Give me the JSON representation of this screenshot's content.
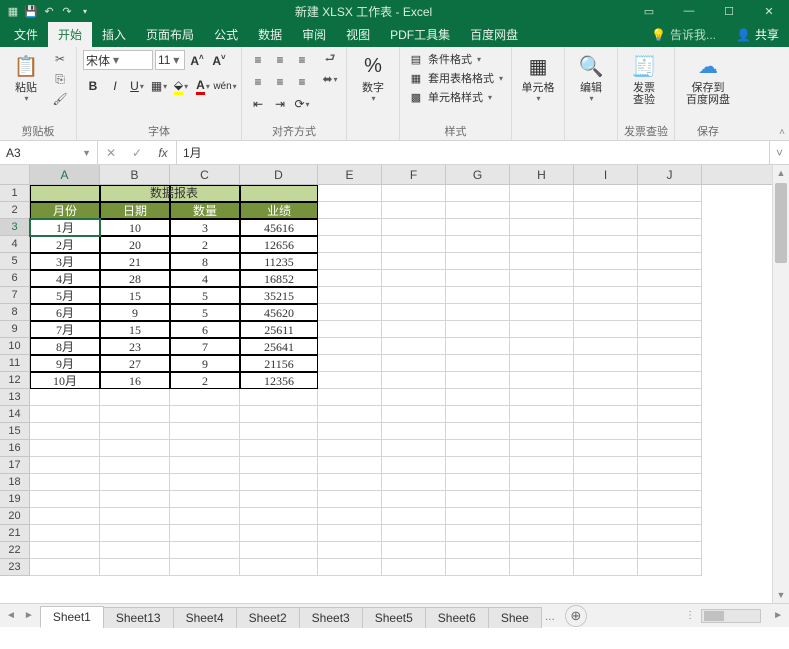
{
  "titlebar": {
    "title": "新建 XLSX 工作表 - Excel"
  },
  "tabs": {
    "items": [
      "文件",
      "开始",
      "插入",
      "页面布局",
      "公式",
      "数据",
      "审阅",
      "视图",
      "PDF工具集",
      "百度网盘"
    ],
    "active": 1,
    "tell_me": "告诉我...",
    "share": "共享"
  },
  "ribbon": {
    "clipboard": {
      "paste": "粘贴",
      "label": "剪贴板"
    },
    "font": {
      "name": "宋体",
      "size": "11",
      "label": "字体"
    },
    "align": {
      "label": "对齐方式"
    },
    "number": {
      "btn": "数字",
      "label": ""
    },
    "styles": {
      "cond": "条件格式",
      "tablefmt": "套用表格格式",
      "cellstyle": "单元格样式",
      "label": "样式"
    },
    "cells": {
      "btn": "单元格",
      "label": ""
    },
    "editing": {
      "btn": "编辑",
      "label": ""
    },
    "invoice": {
      "btn": "发票\n查验",
      "label": "发票查验"
    },
    "baidu": {
      "btn": "保存到\n百度网盘",
      "label": "保存"
    }
  },
  "formula_bar": {
    "name_box": "A3",
    "value": "1月"
  },
  "grid": {
    "columns": [
      "A",
      "B",
      "C",
      "D",
      "E",
      "F",
      "G",
      "H",
      "I",
      "J"
    ],
    "row_count": 23,
    "selected_row": 3,
    "selected_col": "A",
    "title": "数据报表",
    "headers": [
      "月份",
      "日期",
      "数量",
      "业绩"
    ],
    "rows": [
      [
        "1月",
        "10",
        "3",
        "45616"
      ],
      [
        "2月",
        "20",
        "2",
        "12656"
      ],
      [
        "3月",
        "21",
        "8",
        "11235"
      ],
      [
        "4月",
        "28",
        "4",
        "16852"
      ],
      [
        "5月",
        "15",
        "5",
        "35215"
      ],
      [
        "6月",
        "9",
        "5",
        "45620"
      ],
      [
        "7月",
        "15",
        "6",
        "25611"
      ],
      [
        "8月",
        "23",
        "7",
        "25641"
      ],
      [
        "9月",
        "27",
        "9",
        "21156"
      ],
      [
        "10月",
        "16",
        "2",
        "12356"
      ]
    ]
  },
  "sheets": {
    "items": [
      "Sheet1",
      "Sheet13",
      "Sheet4",
      "Sheet2",
      "Sheet3",
      "Sheet5",
      "Sheet6",
      "Shee"
    ],
    "more": "...",
    "active": 0
  }
}
